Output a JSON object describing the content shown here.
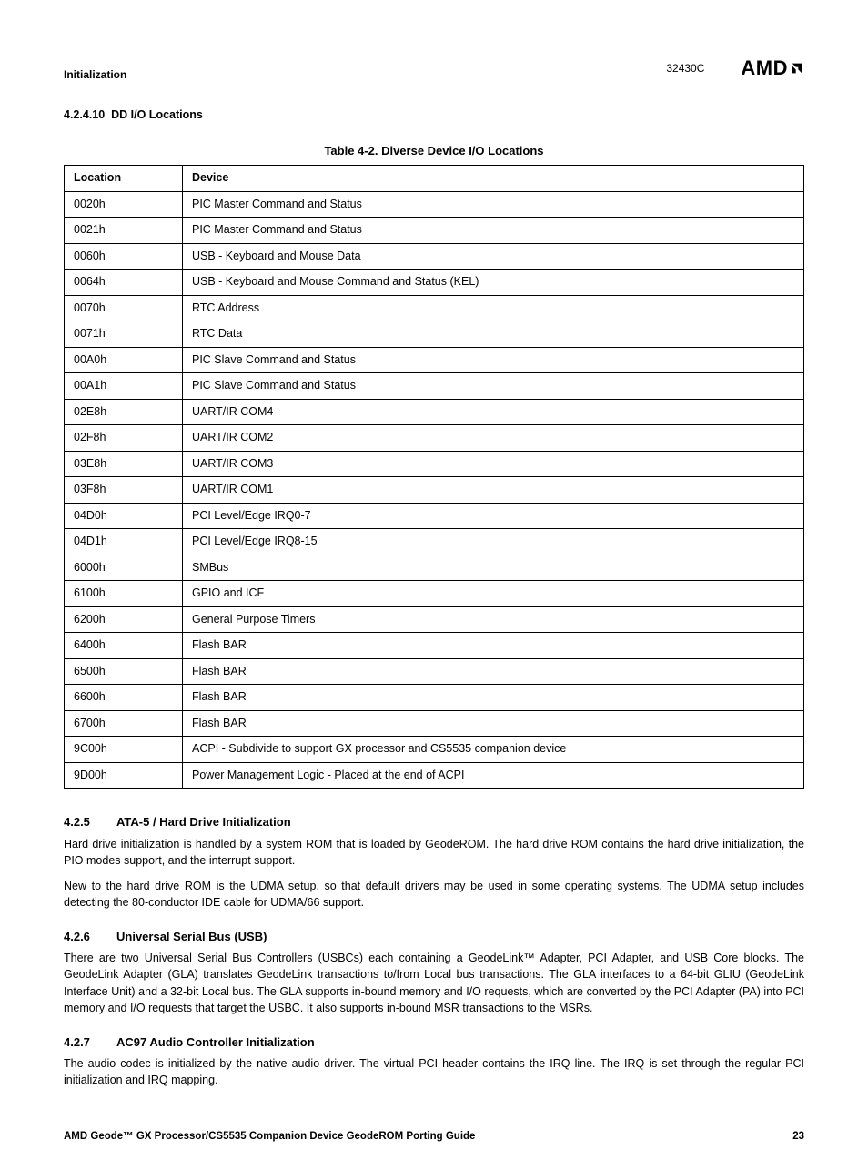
{
  "header": {
    "section": "Initialization",
    "docnum": "32430C",
    "logo": "AMD"
  },
  "section_4_2_4_10": {
    "num": "4.2.4.10",
    "title": "DD I/O Locations"
  },
  "table": {
    "caption": "Table 4-2.  Diverse Device I/O Locations",
    "col1": "Location",
    "col2": "Device",
    "rows": [
      {
        "loc": "0020h",
        "dev": "PIC Master Command and Status"
      },
      {
        "loc": "0021h",
        "dev": "PIC Master Command and Status"
      },
      {
        "loc": "0060h",
        "dev": "USB - Keyboard and Mouse Data"
      },
      {
        "loc": "0064h",
        "dev": "USB - Keyboard and Mouse Command and Status (KEL)"
      },
      {
        "loc": "0070h",
        "dev": "RTC Address"
      },
      {
        "loc": "0071h",
        "dev": "RTC Data"
      },
      {
        "loc": "00A0h",
        "dev": "PIC Slave Command and Status"
      },
      {
        "loc": "00A1h",
        "dev": "PIC Slave Command and Status"
      },
      {
        "loc": "02E8h",
        "dev": "UART/IR COM4"
      },
      {
        "loc": "02F8h",
        "dev": "UART/IR COM2"
      },
      {
        "loc": "03E8h",
        "dev": "UART/IR COM3"
      },
      {
        "loc": "03F8h",
        "dev": "UART/IR COM1"
      },
      {
        "loc": "04D0h",
        "dev": "PCI Level/Edge IRQ0-7"
      },
      {
        "loc": "04D1h",
        "dev": "PCI Level/Edge IRQ8-15"
      },
      {
        "loc": "6000h",
        "dev": "SMBus"
      },
      {
        "loc": "6100h",
        "dev": "GPIO and ICF"
      },
      {
        "loc": "6200h",
        "dev": "General Purpose Timers"
      },
      {
        "loc": "6400h",
        "dev": "Flash BAR"
      },
      {
        "loc": "6500h",
        "dev": "Flash BAR"
      },
      {
        "loc": "6600h",
        "dev": "Flash BAR"
      },
      {
        "loc": "6700h",
        "dev": "Flash BAR"
      },
      {
        "loc": "9C00h",
        "dev": "ACPI - Subdivide to support GX processor and CS5535 companion device"
      },
      {
        "loc": "9D00h",
        "dev": "Power Management Logic - Placed at the end of ACPI"
      }
    ]
  },
  "s425": {
    "num": "4.2.5",
    "title": "ATA-5 / Hard Drive Initialization",
    "p1": "Hard drive initialization is handled by a system ROM that is loaded by GeodeROM. The hard drive ROM contains the hard drive initialization, the PIO modes support, and the interrupt support.",
    "p2": "New to the hard drive ROM is the UDMA setup, so that default drivers may be used in some operating systems. The UDMA setup includes detecting the 80-conductor IDE cable for UDMA/66 support."
  },
  "s426": {
    "num": "4.2.6",
    "title": "Universal Serial Bus (USB)",
    "p1": "There are two Universal Serial Bus Controllers (USBCs) each containing a GeodeLink™ Adapter, PCI Adapter, and USB Core blocks. The GeodeLink Adapter (GLA) translates GeodeLink transactions to/from Local bus transactions. The GLA interfaces to a 64-bit GLIU (GeodeLink Interface Unit) and a 32-bit Local bus. The GLA supports in-bound memory and I/O requests, which are converted by the PCI Adapter (PA) into PCI memory and I/O requests that target the USBC. It also supports in-bound MSR transactions to the MSRs."
  },
  "s427": {
    "num": "4.2.7",
    "title": "AC97 Audio Controller Initialization",
    "p1": "The audio codec is initialized by the native audio driver. The virtual PCI header contains the IRQ line. The IRQ is set through the regular PCI initialization and IRQ mapping."
  },
  "footer": {
    "title": "AMD Geode™ GX Processor/CS5535 Companion Device GeodeROM Porting Guide",
    "page": "23"
  }
}
